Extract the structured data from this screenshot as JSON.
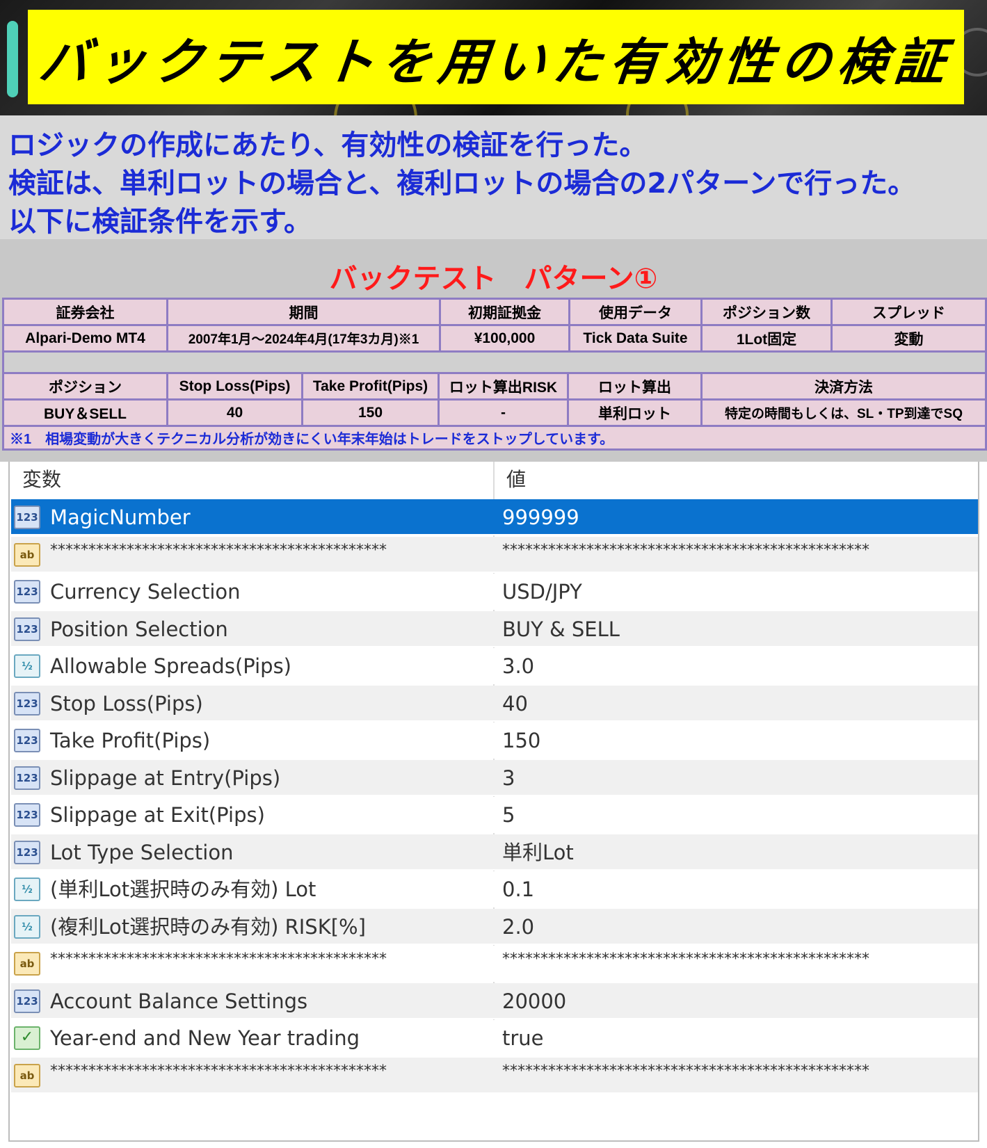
{
  "banner": {
    "title": "バックテストを用いた有効性の検証"
  },
  "intro": {
    "lines": [
      "ロジックの作成にあたり、有効性の検証を行った。",
      "検証は、単利ロットの場合と、複利ロットの場合の2パターンで行った。",
      "以下に検証条件を示す。"
    ]
  },
  "pattern": {
    "title": "バックテスト　パターン①",
    "row1_headers": [
      "証券会社",
      "期間",
      "初期証拠金",
      "使用データ",
      "ポジション数",
      "スプレッド"
    ],
    "row1_values": [
      "Alpari-Demo MT4",
      "2007年1月～2024年4月(17年3カ月)※1",
      "¥100,000",
      "Tick Data Suite",
      "1Lot固定",
      "変動"
    ],
    "row2_headers": [
      "ポジション",
      "Stop Loss(Pips)",
      "Take Profit(Pips)",
      "ロット算出RISK",
      "ロット算出",
      "決済方法"
    ],
    "row2_values": [
      "BUY＆SELL",
      "40",
      "150",
      "-",
      "単利ロット",
      "特定の時間もしくは、SL・TP到達でSQ"
    ],
    "note": "※1　相場変動が大きくテクニカル分析が効きにくい年末年始はトレードをストップしています。"
  },
  "params": {
    "header_name": "変数",
    "header_value": "値",
    "rows": [
      {
        "icon": "123",
        "type": "int",
        "name": "MagicNumber",
        "value": "999999",
        "selected": true
      },
      {
        "icon": "ab",
        "type": "str",
        "name": "********************************************",
        "value": "************************************************"
      },
      {
        "icon": "123",
        "type": "int",
        "name": "Currency Selection",
        "value": "USD/JPY"
      },
      {
        "icon": "123",
        "type": "int",
        "name": "Position Selection",
        "value": "BUY & SELL"
      },
      {
        "icon": "½",
        "type": "dbl",
        "name": "Allowable Spreads(Pips)",
        "value": "3.0"
      },
      {
        "icon": "123",
        "type": "int",
        "name": "Stop Loss(Pips)",
        "value": "40"
      },
      {
        "icon": "123",
        "type": "int",
        "name": "Take Profit(Pips)",
        "value": "150"
      },
      {
        "icon": "123",
        "type": "int",
        "name": "Slippage at Entry(Pips)",
        "value": "3"
      },
      {
        "icon": "123",
        "type": "int",
        "name": "Slippage at Exit(Pips)",
        "value": "5"
      },
      {
        "icon": "123",
        "type": "int",
        "name": "Lot Type Selection",
        "value": "単利Lot"
      },
      {
        "icon": "½",
        "type": "dbl",
        "name": "(単利Lot選択時のみ有効) Lot",
        "value": "0.1"
      },
      {
        "icon": "½",
        "type": "dbl",
        "name": "(複利Lot選択時のみ有効) RISK[%]",
        "value": "2.0"
      },
      {
        "icon": "ab",
        "type": "str",
        "name": "********************************************",
        "value": "************************************************"
      },
      {
        "icon": "123",
        "type": "int",
        "name": "Account Balance Settings",
        "value": "20000"
      },
      {
        "icon": "✓",
        "type": "bool",
        "name": "Year-end and New Year trading",
        "value": "true"
      },
      {
        "icon": "ab",
        "type": "str",
        "name": "********************************************",
        "value": "************************************************"
      }
    ]
  }
}
